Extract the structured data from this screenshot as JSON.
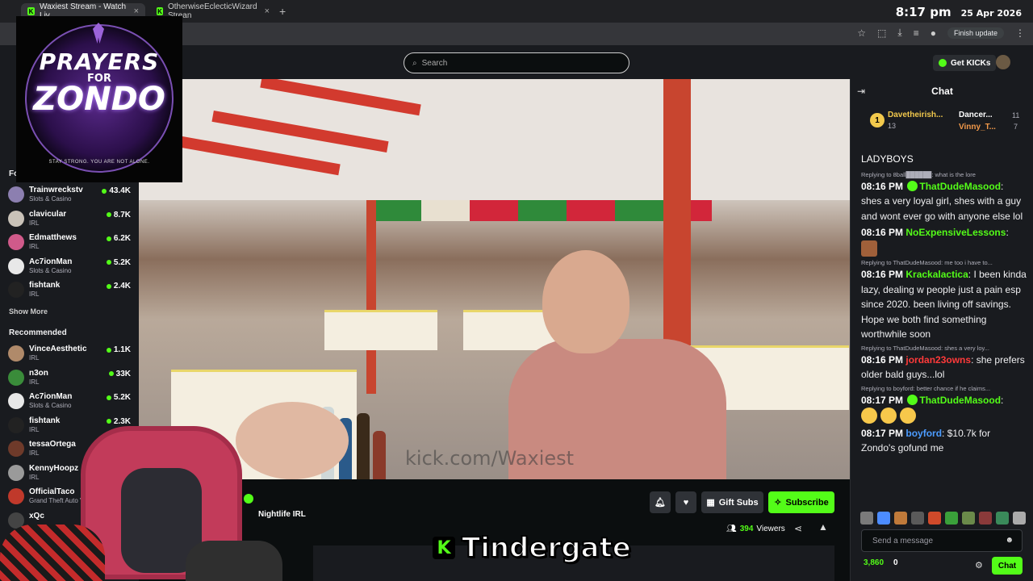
{
  "browser": {
    "tabs": [
      {
        "title": "Waxiest Stream - Watch Liv"
      },
      {
        "title": "OtherwiseEclecticWizard Strean"
      }
    ],
    "new_tab": "+",
    "clock_time": "8:17 pm",
    "clock_date": "25 Apr 2026",
    "finish_update": "Finish update"
  },
  "overlay_logo": {
    "line1": "PRAYERS",
    "line2": "FOR",
    "line3": "ZONDO",
    "tagline": "STAY STRONG. YOU ARE NOT ALONE."
  },
  "topnav": {
    "search_placeholder": "Search",
    "get_kicks": "Get KICKs"
  },
  "sidebar": {
    "following_label": "Fo",
    "following": [
      {
        "name": "Trainwreckstv",
        "category": "Slots & Casino",
        "viewers": "43.4K",
        "color": "#8c7fb0"
      },
      {
        "name": "clavicular",
        "category": "IRL",
        "viewers": "8.7K",
        "color": "#c9c2b8"
      },
      {
        "name": "Edmatthews",
        "category": "IRL",
        "viewers": "6.2K",
        "color": "#d05a8a"
      },
      {
        "name": "Ac7ionMan",
        "category": "Slots & Casino",
        "viewers": "5.2K",
        "color": "#e8e8e8"
      },
      {
        "name": "fishtank",
        "category": "IRL",
        "viewers": "2.4K",
        "color": "#222222"
      }
    ],
    "show_more": "Show More",
    "recommended_label": "Recommended",
    "recommended": [
      {
        "name": "VinceAesthetic",
        "category": "IRL",
        "viewers": "1.1K",
        "color": "#b08a6a"
      },
      {
        "name": "n3on",
        "category": "IRL",
        "viewers": "33K",
        "color": "#3a8c3a"
      },
      {
        "name": "Ac7ionMan",
        "category": "Slots & Casino",
        "viewers": "5.2K",
        "color": "#e8e8e8"
      },
      {
        "name": "fishtank",
        "category": "IRL",
        "viewers": "2.3K",
        "color": "#222222"
      },
      {
        "name": "tessaOrtega",
        "category": "IRL",
        "viewers": "42",
        "color": "#6e3a2a"
      },
      {
        "name": "KennyHoopz",
        "category": "IRL",
        "viewers": "",
        "color": "#9a9a9a"
      },
      {
        "name": "OfficialTaco",
        "category": "Grand Theft Auto V",
        "viewers": "",
        "color": "#c0392b"
      },
      {
        "name": "xQc",
        "category": "",
        "viewers": "",
        "color": "#444444"
      }
    ]
  },
  "video": {
    "watermark": "kick.com/Waxiest"
  },
  "stream_info": {
    "category": "Nightlife IRL",
    "gift_subs": "Gift Subs",
    "subscribe": "Subscribe",
    "viewers_count": "394",
    "viewers_label": "Viewers",
    "caption_logo": "K",
    "caption": "Tindergate"
  },
  "chat": {
    "title": "Chat",
    "gifters": [
      {
        "rank": "1",
        "name": "Davetheirish...",
        "count": "13"
      },
      {
        "name": "Dancer...",
        "count": "11"
      },
      {
        "name": "Vinny_T...",
        "count": "7"
      }
    ],
    "pinned": "LADYBOYS",
    "messages": [
      {
        "reply": "Replying to 8ball██████: what is the lore",
        "time": "08:16 PM",
        "user": "ThatDudeMasood",
        "color": "#53fc18",
        "text": "shes a very loyal girl, shes with a guy and wont ever go with anyone else lol",
        "badge": true
      },
      {
        "reply": "",
        "time": "08:16 PM",
        "user": "NoExpensiveLessons",
        "color": "#53fc18",
        "text": "",
        "badge": false,
        "emote_line": true
      },
      {
        "reply": "Replying to ThatDudeMasood: me too i have to...",
        "time": "08:16 PM",
        "user": "Krackalactica",
        "color": "#53fc18",
        "text": "I been kinda lazy, dealing w people just a pain esp since 2020. been living off savings. Hope we both find something worthwhile soon",
        "badge": false
      },
      {
        "reply": "Replying to ThatDudeMasood: shes a very loy...",
        "time": "08:16 PM",
        "user": "jordan23owns",
        "color": "#ff3a3a",
        "text": "she prefers older bald guys...lol",
        "badge": false
      },
      {
        "reply": "Replying to boyford: better chance if he claims...",
        "time": "08:17 PM",
        "user": "ThatDudeMasood",
        "color": "#53fc18",
        "text": "",
        "badge": true,
        "emotes": 3
      },
      {
        "reply": "",
        "time": "08:17 PM",
        "user": "boyford",
        "color": "#4c9cff",
        "text": "$10.7k for Zondo's gofund me",
        "badge": false
      }
    ],
    "send_placeholder": "Send a message",
    "points": "3,860",
    "zero": "0",
    "chat_button": "Chat"
  }
}
